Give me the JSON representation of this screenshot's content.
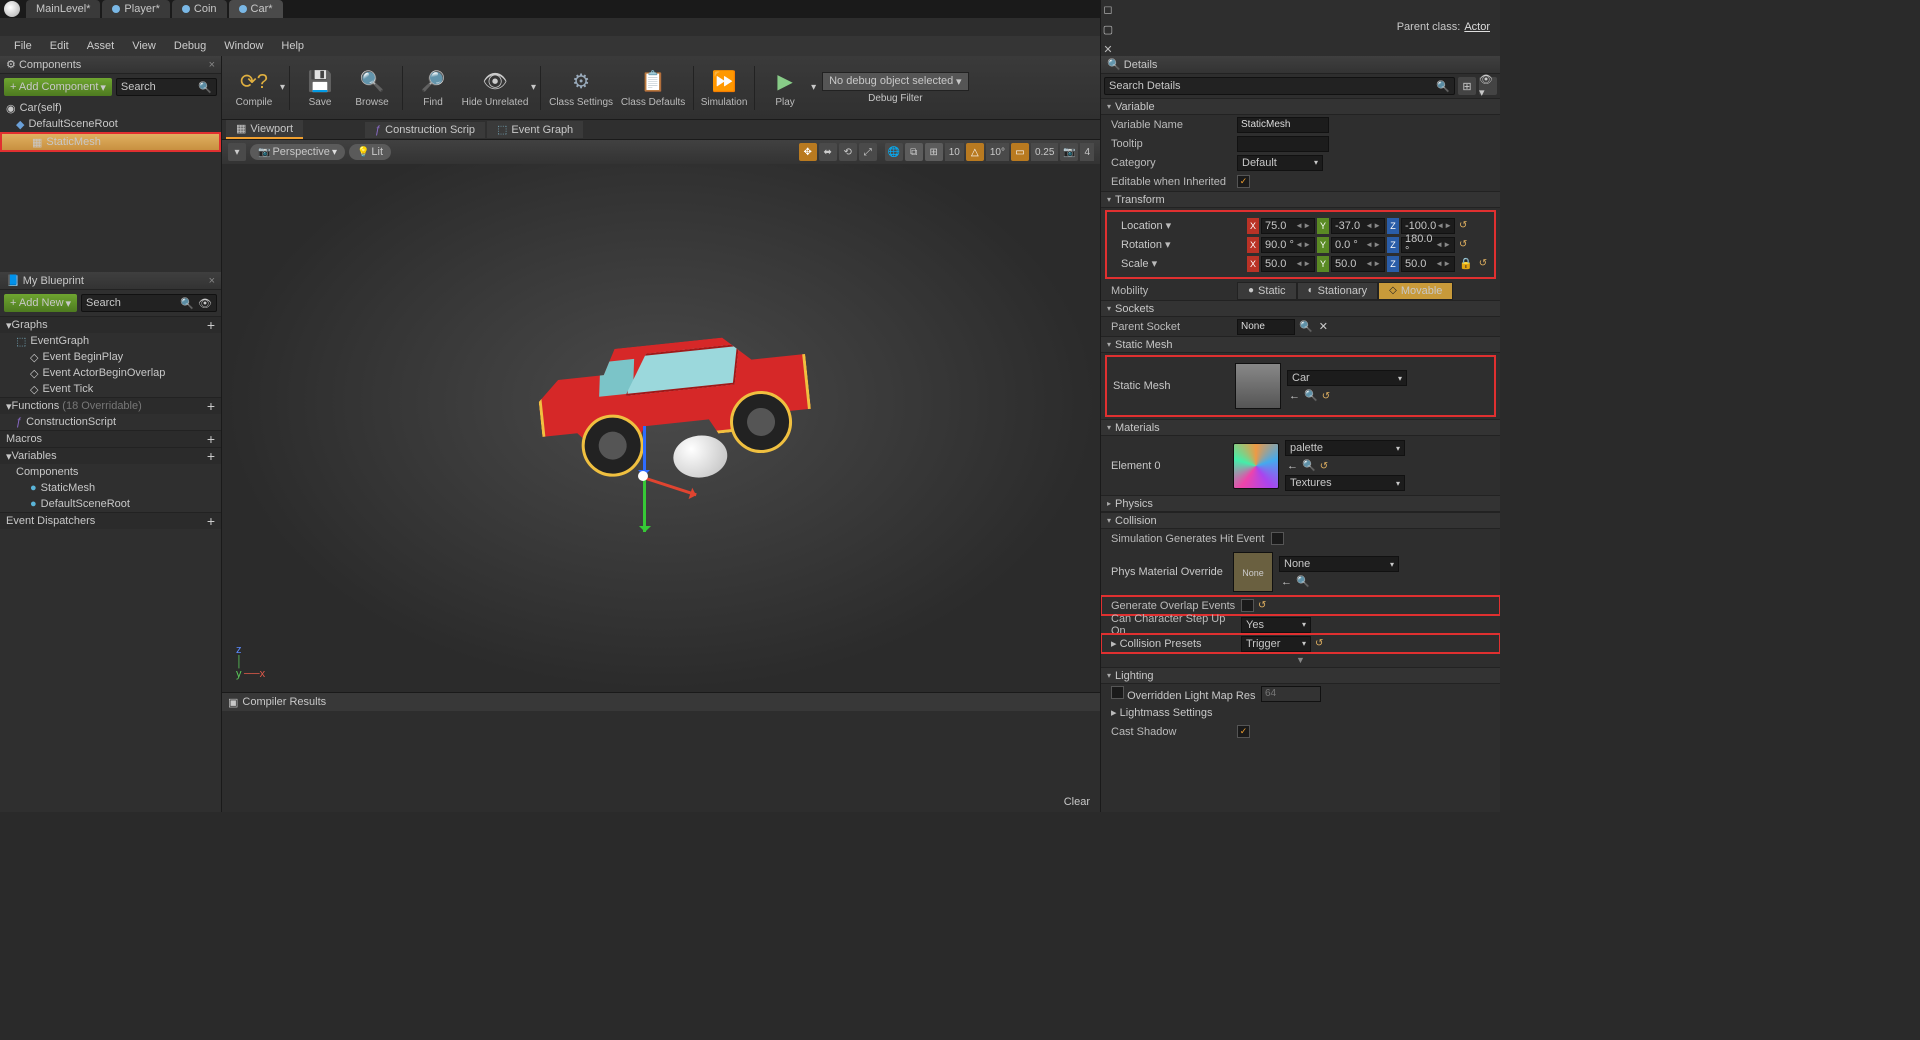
{
  "titlebar": {
    "tabs": [
      "MainLevel*",
      "Player*",
      "Coin",
      "Car*"
    ]
  },
  "parent_class_label": "Parent class:",
  "parent_class_value": "Actor",
  "menu": [
    "File",
    "Edit",
    "Asset",
    "View",
    "Debug",
    "Window",
    "Help"
  ],
  "left": {
    "components_title": "Components",
    "add_component": "+ Add Component",
    "search_placeholder": "Search",
    "tree": {
      "root": "Car(self)",
      "child1": "DefaultSceneRoot",
      "child2": "StaticMesh"
    },
    "my_blueprint": "My Blueprint",
    "add_new": "+ Add New",
    "graphs": "Graphs",
    "event_graph": "EventGraph",
    "event_beginplay": "Event BeginPlay",
    "event_overlap": "Event ActorBeginOverlap",
    "event_tick": "Event Tick",
    "functions": "Functions",
    "functions_suffix": "(18 Overridable)",
    "construction_script": "ConstructionScript",
    "macros": "Macros",
    "variables": "Variables",
    "components_sec": "Components",
    "var_staticmesh": "StaticMesh",
    "var_defaultsceneroot": "DefaultSceneRoot",
    "event_dispatchers": "Event Dispatchers"
  },
  "toolbar": {
    "compile": "Compile",
    "save": "Save",
    "browse": "Browse",
    "find": "Find",
    "hide": "Hide Unrelated",
    "class_settings": "Class Settings",
    "class_defaults": "Class Defaults",
    "simulation": "Simulation",
    "play": "Play",
    "debug_sel": "No debug object selected",
    "debug_filter": "Debug Filter"
  },
  "center_tabs": {
    "viewport": "Viewport",
    "construction": "Construction Scrip",
    "event_graph": "Event Graph"
  },
  "vp_toolbar": {
    "perspective": "Perspective",
    "lit": "Lit",
    "grid": "10",
    "angle": "10°",
    "scale_snap": "0.25",
    "cam": "4"
  },
  "compiler": {
    "title": "Compiler Results",
    "clear": "Clear"
  },
  "details": {
    "title": "Details",
    "search": "Search Details",
    "variable_cat": "Variable",
    "variable_name_lbl": "Variable Name",
    "variable_name_val": "StaticMesh",
    "tooltip_lbl": "Tooltip",
    "category_lbl": "Category",
    "category_val": "Default",
    "editable_lbl": "Editable when Inherited",
    "transform_cat": "Transform",
    "location_lbl": "Location",
    "rotation_lbl": "Rotation",
    "scale_lbl": "Scale",
    "loc": {
      "x": "75.0",
      "y": "-37.0",
      "z": "-100.0"
    },
    "rot": {
      "x": "90.0 °",
      "y": "0.0 °",
      "z": "180.0 °"
    },
    "scl": {
      "x": "50.0",
      "y": "50.0",
      "z": "50.0"
    },
    "mobility_lbl": "Mobility",
    "mobility": {
      "static": "Static",
      "stationary": "Stationary",
      "movable": "Movable"
    },
    "sockets_cat": "Sockets",
    "parent_socket_lbl": "Parent Socket",
    "parent_socket_val": "None",
    "static_mesh_cat": "Static Mesh",
    "static_mesh_lbl": "Static Mesh",
    "static_mesh_val": "Car",
    "materials_cat": "Materials",
    "element0_lbl": "Element 0",
    "element0_val": "palette",
    "textures_btn": "Textures",
    "physics_cat": "Physics",
    "collision_cat": "Collision",
    "sim_hit_lbl": "Simulation Generates Hit Event",
    "phys_mat_lbl": "Phys Material Override",
    "phys_mat_val": "None",
    "gen_overlap_lbl": "Generate Overlap Events",
    "can_step_lbl": "Can Character Step Up On",
    "can_step_val": "Yes",
    "collision_presets_lbl": "Collision Presets",
    "collision_presets_val": "Trigger",
    "lighting_cat": "Lighting",
    "override_lightmap_lbl": "Overridden Light Map Res",
    "override_lightmap_val": "64",
    "lightmass_lbl": "Lightmass Settings",
    "cast_shadow_lbl": "Cast Shadow"
  }
}
